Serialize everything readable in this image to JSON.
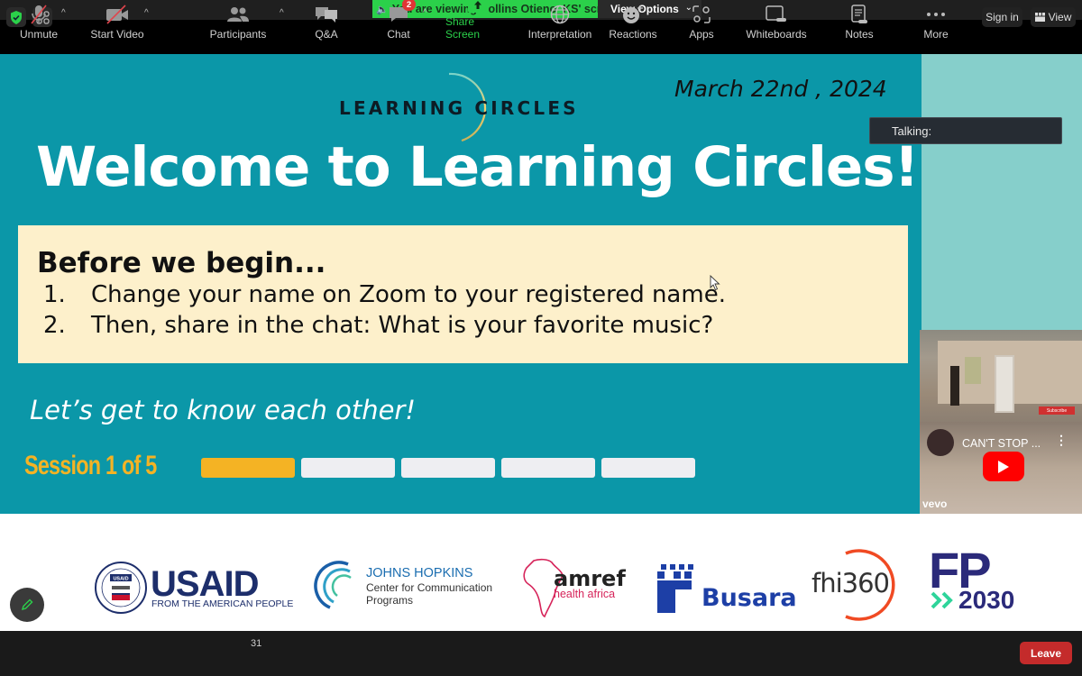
{
  "topbar": {
    "security_icon": "shield-check-icon",
    "apps_icon": "grid-icon",
    "viewing_banner": "You are viewing Collins Otieno_KS' screen",
    "view_options": "View Options",
    "sign_in": "Sign in",
    "view": "View"
  },
  "slide": {
    "logo_text": "LEARNING CIRCLES",
    "date": "March 22nd , 2024",
    "title": "Welcome to Learning Circles!",
    "before": {
      "heading": "Before we begin...",
      "items": [
        {
          "num": "1.",
          "text": "Change your name on Zoom to your registered name."
        },
        {
          "num": "2.",
          "text": "Then, share in the chat: What is your favorite music?"
        }
      ]
    },
    "subtitle": "Let’s get to know each other!",
    "session_label": "Session 1 of 5",
    "session_progress": {
      "current": 1,
      "total": 5
    },
    "colors": {
      "accent": "#f4b324",
      "background": "#0b97a8",
      "box": "#fdf0cb"
    }
  },
  "talking": {
    "label": "Talking:"
  },
  "video": {
    "subscribe": "Subscribe",
    "title": "CAN'T STOP ...",
    "brand": "vevo"
  },
  "partners": {
    "usaid_main": "USAID",
    "usaid_sub": "FROM THE AMERICAN PEOPLE",
    "usaid_seal": "USAID",
    "jh_main": "JOHNS HOPKINS",
    "jh_sub1": "Center for Communication",
    "jh_sub2": "Programs",
    "amref_main": "amref",
    "amref_sub": "health africa",
    "busara": "Busara",
    "fhi": "fhi360",
    "fp_main": "FP",
    "fp_sub": "2030"
  },
  "toolbar": {
    "unmute": "Unmute",
    "start_video": "Start Video",
    "participants": "Participants",
    "participants_count": "31",
    "qa": "Q&A",
    "chat": "Chat",
    "chat_badge": "2",
    "share_screen": "Share Screen",
    "interpretation": "Interpretation",
    "reactions": "Reactions",
    "apps": "Apps",
    "whiteboards": "Whiteboards",
    "notes": "Notes",
    "more": "More",
    "leave": "Leave",
    "colors": {
      "share": "#2bd14a",
      "leave": "#c42b2b",
      "badge": "#e03535"
    }
  }
}
